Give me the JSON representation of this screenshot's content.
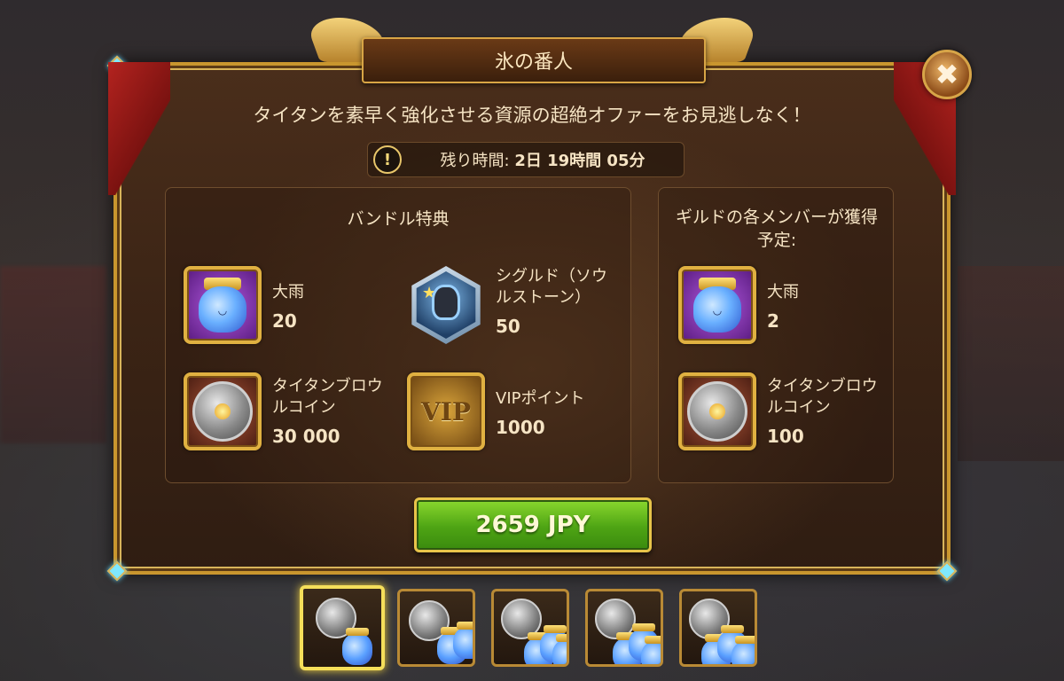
{
  "title": "氷の番人",
  "close_label": "✖",
  "subtitle": "タイタンを素早く強化させる資源の超絶オファーをお見逃しなく！",
  "timer": {
    "icon": "!",
    "label": "残り時間:",
    "value": "2日 19時間 05分"
  },
  "bundle": {
    "title": "バンドル特典",
    "items": [
      {
        "name": "大雨",
        "qty": "20",
        "icon": "rain-jar-icon"
      },
      {
        "name": "シグルド（ソウルストーン）",
        "qty": "50",
        "icon": "soulstone-icon"
      },
      {
        "name": "タイタンブロウルコイン",
        "qty": "30 000",
        "icon": "titan-coin-icon"
      },
      {
        "name": "VIPポイント",
        "qty": "1000",
        "icon": "vip-icon"
      }
    ]
  },
  "guild": {
    "title": "ギルドの各メンバーが獲得予定:",
    "items": [
      {
        "name": "大雨",
        "qty": "2",
        "icon": "rain-jar-icon"
      },
      {
        "name": "タイタンブロウルコイン",
        "qty": "100",
        "icon": "titan-coin-icon"
      }
    ]
  },
  "vip_text": "VIP",
  "price": "2659 JPY",
  "tiers": {
    "count": 5,
    "active_index": 0
  },
  "colors": {
    "gold_border": "#e0b141",
    "panel_bg": "#3b2415",
    "buy_green": "#4ea414",
    "text": "#f6e4c4"
  }
}
